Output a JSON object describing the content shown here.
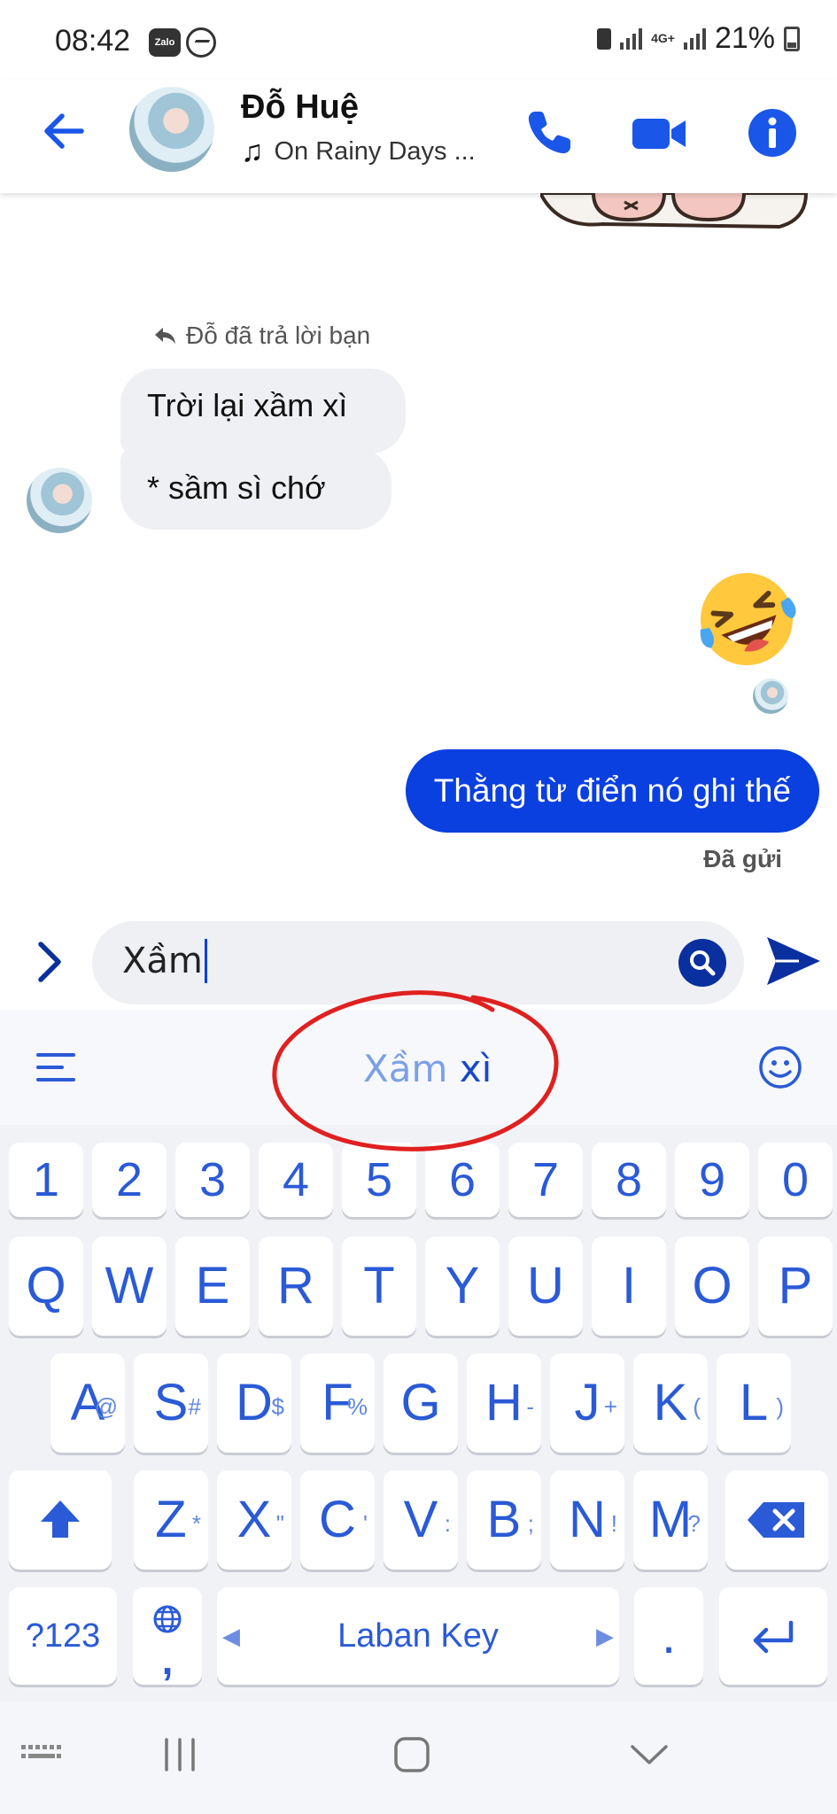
{
  "status_bar": {
    "time": "08:42",
    "zalo_label": "Zalo",
    "network": "4G+",
    "battery": "21%"
  },
  "header": {
    "contact_name": "Đỗ Huệ",
    "status": "On Rainy Days ..."
  },
  "chat": {
    "reply_note": "Đỗ đã trả lời bạn",
    "incoming": [
      "Trời lại xầm xì",
      "* sầm sì chớ"
    ],
    "outgoing": "Thằng từ điển nó ghi thế",
    "sent_status": "Đã gửi",
    "emoji": "rolling-on-floor-laughing"
  },
  "composer": {
    "input_value": "Xầm"
  },
  "keyboard": {
    "suggestion_prefix": "Xầm",
    "suggestion_suffix": " xì",
    "number_row": [
      "1",
      "2",
      "3",
      "4",
      "5",
      "6",
      "7",
      "8",
      "9",
      "0"
    ],
    "row1": [
      "Q",
      "W",
      "E",
      "R",
      "T",
      "Y",
      "U",
      "I",
      "O",
      "P"
    ],
    "row2": [
      {
        "key": "A",
        "hint": "@"
      },
      {
        "key": "S",
        "hint": "#"
      },
      {
        "key": "D",
        "hint": "$"
      },
      {
        "key": "F",
        "hint": "%"
      },
      {
        "key": "G",
        "hint": ""
      },
      {
        "key": "H",
        "hint": "-"
      },
      {
        "key": "J",
        "hint": "+"
      },
      {
        "key": "K",
        "hint": "("
      },
      {
        "key": "L",
        "hint": ")"
      }
    ],
    "row3": [
      {
        "key": "Z",
        "hint": "*"
      },
      {
        "key": "X",
        "hint": "\""
      },
      {
        "key": "C",
        "hint": "'"
      },
      {
        "key": "V",
        "hint": ":"
      },
      {
        "key": "B",
        "hint": ";"
      },
      {
        "key": "N",
        "hint": "!"
      },
      {
        "key": "M",
        "hint": "?"
      }
    ],
    "symbols_key": "?123",
    "comma_key": ",",
    "space_label": "Laban Key",
    "period_key": "."
  },
  "colors": {
    "accent": "#0a3fe0",
    "key_text": "#2a5ad6",
    "annotation_red": "#e02020"
  }
}
